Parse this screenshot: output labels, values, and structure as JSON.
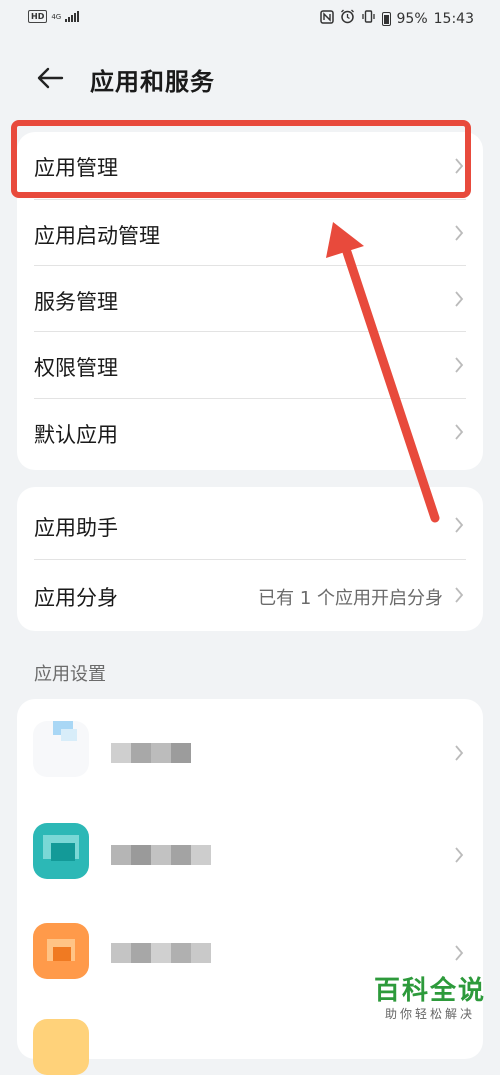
{
  "status_bar": {
    "hd": "HD",
    "network": "4G",
    "battery": "95%",
    "time": "15:43"
  },
  "header": {
    "title": "应用和服务"
  },
  "group1": [
    {
      "label": "应用管理"
    },
    {
      "label": "应用启动管理"
    },
    {
      "label": "服务管理"
    },
    {
      "label": "权限管理"
    },
    {
      "label": "默认应用"
    }
  ],
  "group2": [
    {
      "label": "应用助手",
      "value": ""
    },
    {
      "label": "应用分身",
      "value": "已有 1 个应用开启分身"
    }
  ],
  "section": {
    "app_settings": "应用设置"
  },
  "colors": {
    "accent_red": "#e84a3c",
    "watermark_green": "#2d9a3b"
  },
  "watermark": {
    "main": "百科全说",
    "sub": "助你轻松解决"
  }
}
